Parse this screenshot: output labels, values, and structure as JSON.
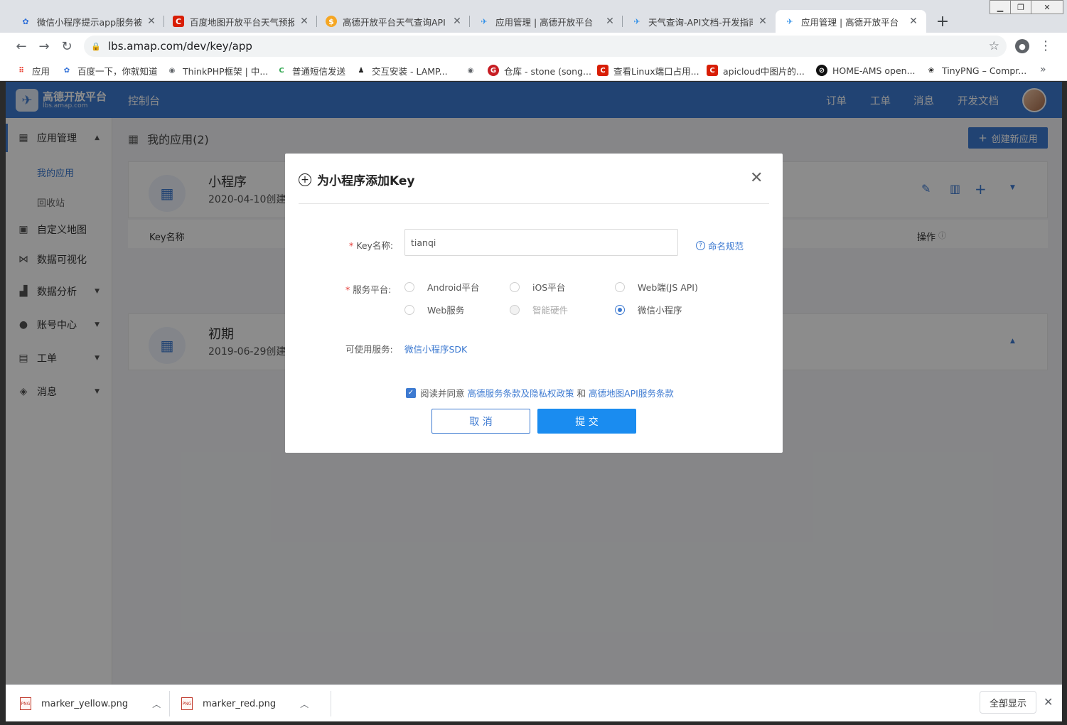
{
  "browser": {
    "tabs": [
      {
        "title": "微信小程序提示app服务被...",
        "icon": "baidu-paw-icon"
      },
      {
        "title": "百度地图开放平台天气预报...",
        "icon": "csdn-c-icon"
      },
      {
        "title": "高德开放平台天气查询API |",
        "icon": "moneybag-icon"
      },
      {
        "title": "应用管理 | 高德开放平台",
        "icon": "amap-plane-icon"
      },
      {
        "title": "天气查询-API文档-开发指南",
        "icon": "amap-plane-icon"
      },
      {
        "title": "应用管理 | 高德开放平台",
        "icon": "amap-plane-icon"
      }
    ],
    "url": "lbs.amap.com/dev/key/app",
    "bookmarks": [
      {
        "label": "应用",
        "icon": "apps-grid-icon"
      },
      {
        "label": "百度一下，你就知道",
        "icon": "baidu-paw-icon"
      },
      {
        "label": "ThinkPHP框架 | 中...",
        "icon": "globe-icon"
      },
      {
        "label": "普通短信发送",
        "icon": "chrome-c-icon"
      },
      {
        "label": "交互安装 - LAMP...",
        "icon": "penguin-icon"
      },
      {
        "label": "",
        "icon": "globe-icon"
      },
      {
        "label": "仓库 - stone (song...",
        "icon": "gitee-icon"
      },
      {
        "label": "查看Linux端口占用...",
        "icon": "csdn-c-icon"
      },
      {
        "label": "apicloud中图片的...",
        "icon": "csdn-c-icon"
      },
      {
        "label": "HOME-AMS open...",
        "icon": "ams-icon"
      },
      {
        "label": "TinyPNG – Compr...",
        "icon": "panda-icon"
      }
    ]
  },
  "header": {
    "logo_text": "高德开放平台",
    "logo_sub": "lbs.amap.com",
    "console": "控制台",
    "nav": [
      "订单",
      "工单",
      "消息",
      "开发文档"
    ]
  },
  "sidebar": {
    "items": [
      {
        "label": "应用管理",
        "icon": "apps-icon"
      },
      {
        "label": "自定义地图",
        "icon": "map-icon"
      },
      {
        "label": "数据可视化",
        "icon": "share-icon"
      },
      {
        "label": "数据分析",
        "icon": "chart-icon"
      },
      {
        "label": "账号中心",
        "icon": "user-icon"
      },
      {
        "label": "工单",
        "icon": "clipboard-icon"
      },
      {
        "label": "消息",
        "icon": "chat-icon"
      }
    ],
    "sub_items": [
      "我的应用",
      "回收站"
    ]
  },
  "main": {
    "title": "我的应用(2)",
    "create_button": "创建新应用",
    "apps": [
      {
        "name": "小程序",
        "date": "2020-04-10创建"
      },
      {
        "name": "初期",
        "date": "2019-06-29创建"
      }
    ],
    "table_headers": {
      "key_name": "Key名称",
      "actions": "操作"
    }
  },
  "modal": {
    "title": "为小程序添加Key",
    "key_label": "Key名称:",
    "key_value": "tianqi",
    "naming_link": "命名规范",
    "platform_label": "服务平台:",
    "platforms": [
      {
        "label": "Android平台",
        "checked": false,
        "disabled": false
      },
      {
        "label": "iOS平台",
        "checked": false,
        "disabled": false
      },
      {
        "label": "Web端(JS API)",
        "checked": false,
        "disabled": false
      },
      {
        "label": "Web服务",
        "checked": false,
        "disabled": false
      },
      {
        "label": "智能硬件",
        "checked": false,
        "disabled": true
      },
      {
        "label": "微信小程序",
        "checked": true,
        "disabled": false
      }
    ],
    "services_label": "可使用服务:",
    "services_value": "微信小程序SDK",
    "agree_prefix": "阅读并同意",
    "agree_link1": "高德服务条款及隐私权政策",
    "agree_and": "和",
    "agree_link2": "高德地图API服务条款",
    "cancel": "取 消",
    "submit": "提 交"
  },
  "downloads": {
    "files": [
      "marker_yellow.png",
      "marker_red.png"
    ],
    "show_all": "全部显示"
  },
  "colors": {
    "brand": "#3d7ad1",
    "submit": "#1a8cf0",
    "required": "#e53935"
  }
}
